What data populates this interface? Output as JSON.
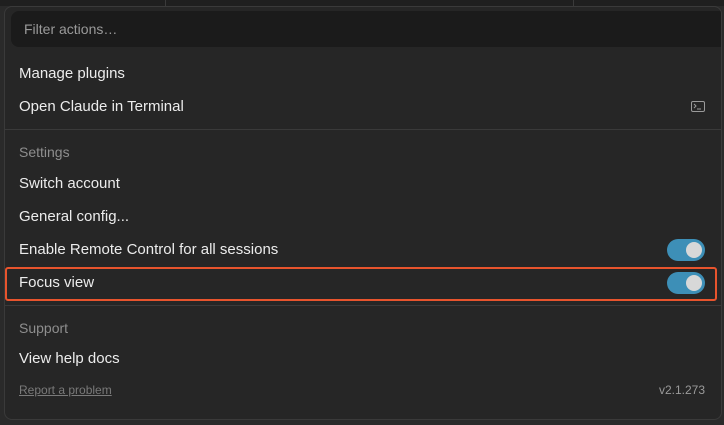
{
  "filter": {
    "placeholder": "Filter actions…"
  },
  "actions": [
    {
      "label": "Manage plugins"
    },
    {
      "label": "Open Claude in Terminal",
      "icon": "terminal-icon"
    }
  ],
  "settings": {
    "heading": "Settings",
    "items": [
      {
        "label": "Switch account"
      },
      {
        "label": "General config..."
      },
      {
        "label": "Enable Remote Control for all sessions",
        "toggle": true
      },
      {
        "label": "Focus view",
        "toggle": true,
        "highlighted": true
      }
    ]
  },
  "support": {
    "heading": "Support",
    "items": [
      {
        "label": "View help docs"
      }
    ]
  },
  "footer": {
    "report_link": "Report a problem",
    "version": "v2.1.273"
  },
  "colors": {
    "toggle_on": "#3d8fb7",
    "highlight": "#e8542d",
    "panel_bg": "#262626"
  }
}
